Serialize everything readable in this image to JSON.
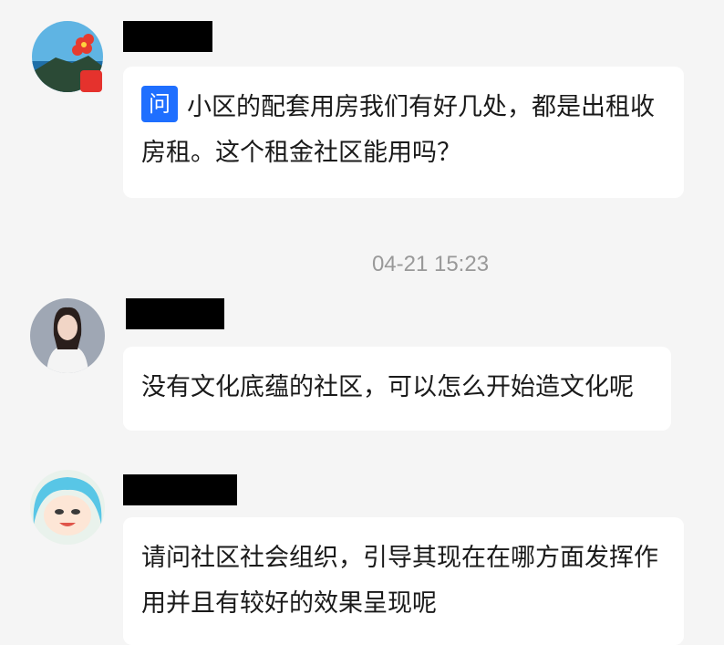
{
  "messages": [
    {
      "question_badge": "问",
      "text": "小区的配套用房我们有好几处，都是出租收房租。这个租金社区能用吗？"
    },
    {
      "text": "没有文化底蕴的社区，可以怎么开始造文化呢"
    },
    {
      "text": "请问社区社会组织，引导其现在在哪方面发挥作用并且有较好的效果呈现呢"
    }
  ],
  "timestamp": "04-21 15:23"
}
